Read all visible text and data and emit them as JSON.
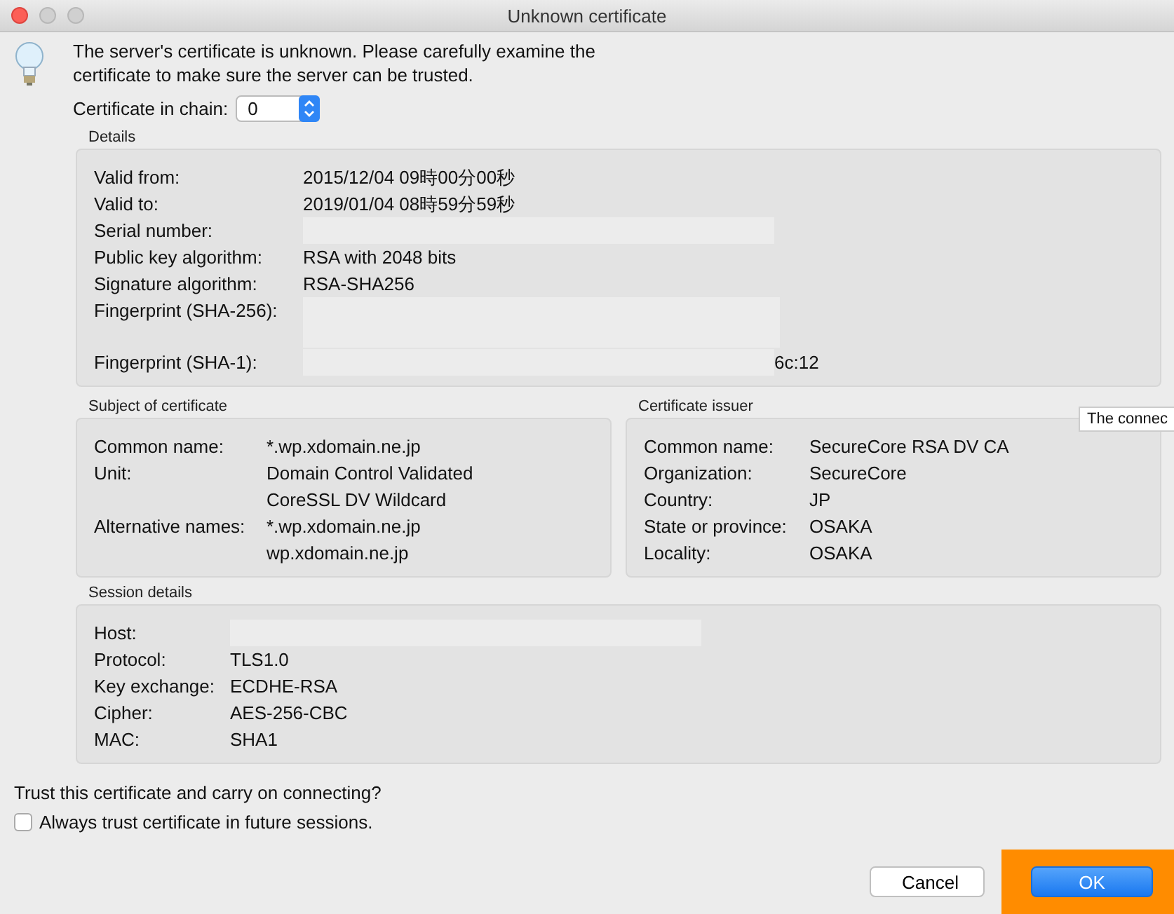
{
  "window": {
    "title": "Unknown certificate"
  },
  "message": "The server's certificate is unknown. Please carefully examine the certificate to make sure the server can be trusted.",
  "chain": {
    "label": "Certificate in chain:",
    "value": "0"
  },
  "details": {
    "title": "Details",
    "rows": [
      {
        "label": "Valid from:",
        "values": [
          "2015/12/04 09時00分00秒"
        ]
      },
      {
        "label": "Valid to:",
        "values": [
          "2019/01/04 08時59分59秒"
        ]
      },
      {
        "label": "Serial number:",
        "redacted": true,
        "values": []
      },
      {
        "label": "Public key algorithm:",
        "values": [
          "RSA with 2048 bits"
        ]
      },
      {
        "label": "Signature algorithm:",
        "values": [
          "RSA-SHA256"
        ]
      },
      {
        "label": "Fingerprint (SHA-256):",
        "redacted": true,
        "tall": true,
        "values": []
      },
      {
        "label": "Fingerprint (SHA-1):",
        "redacted": true,
        "values": [
          "6c:12"
        ]
      }
    ]
  },
  "subject": {
    "title": "Subject of certificate",
    "rows": [
      {
        "label": "Common name:",
        "values": [
          "*.wp.xdomain.ne.jp"
        ]
      },
      {
        "label": "Unit:",
        "values": [
          "Domain Control Validated",
          "CoreSSL DV Wildcard"
        ]
      },
      {
        "label": "Alternative names:",
        "values": [
          "*.wp.xdomain.ne.jp",
          "wp.xdomain.ne.jp"
        ]
      }
    ]
  },
  "issuer": {
    "title": "Certificate issuer",
    "rows": [
      {
        "label": "Common name:",
        "values": [
          "SecureCore RSA DV CA"
        ]
      },
      {
        "label": "Organization:",
        "values": [
          "SecureCore"
        ]
      },
      {
        "label": "Country:",
        "values": [
          "JP"
        ]
      },
      {
        "label": "State or province:",
        "values": [
          "OSAKA"
        ]
      },
      {
        "label": "Locality:",
        "values": [
          "OSAKA"
        ]
      }
    ]
  },
  "tooltip": "The connec",
  "session": {
    "title": "Session details",
    "rows": [
      {
        "label": "Host:",
        "redacted": true,
        "values": []
      },
      {
        "label": "Protocol:",
        "values": [
          "TLS1.0"
        ]
      },
      {
        "label": "Key exchange:",
        "values": [
          "ECDHE-RSA"
        ]
      },
      {
        "label": "Cipher:",
        "values": [
          "AES-256-CBC"
        ]
      },
      {
        "label": "MAC:",
        "values": [
          "SHA1"
        ]
      }
    ]
  },
  "question": "Trust this certificate and carry on connecting?",
  "always_trust": {
    "label": "Always trust certificate in future sessions.",
    "checked": false
  },
  "buttons": [
    {
      "label": "Cancel",
      "kind": "secondary"
    },
    {
      "label": "OK",
      "kind": "default",
      "highlighted": true
    }
  ]
}
